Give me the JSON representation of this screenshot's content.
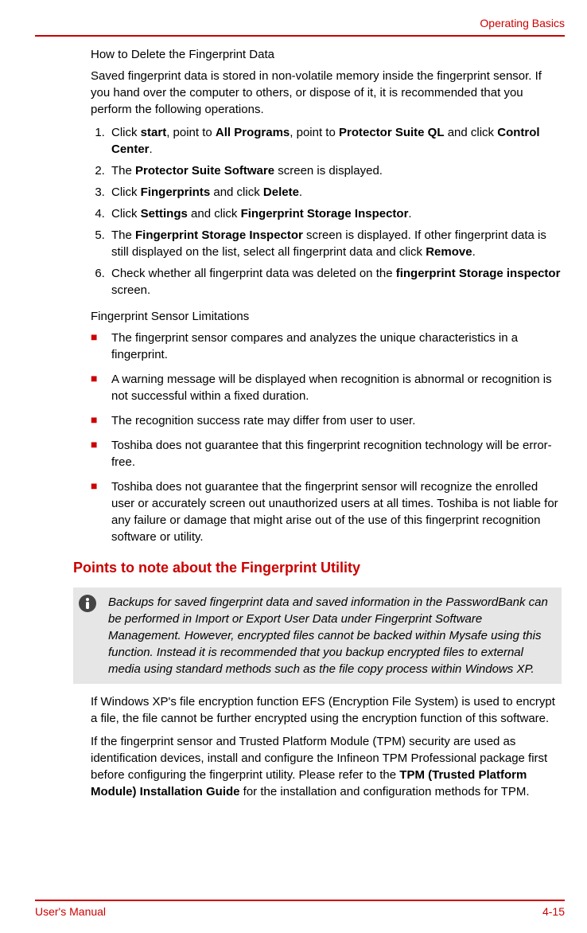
{
  "header": {
    "section_title": "Operating Basics"
  },
  "body": {
    "howto_title": "How to Delete the Fingerprint Data",
    "howto_intro": "Saved fingerprint data is stored in non-volatile memory inside the fingerprint sensor. If you hand over the computer to others, or dispose of it, it is recommended that you perform the following operations.",
    "steps": {
      "s1_pre": "Click ",
      "s1_b1": "start",
      "s1_mid1": ", point to ",
      "s1_b2": "All Programs",
      "s1_mid2": ", point to ",
      "s1_b3": "Protector Suite QL",
      "s1_mid3": " and click ",
      "s1_b4": "Control Center",
      "s1_end": ".",
      "s2_pre": "The ",
      "s2_b1": "Protector Suite Software",
      "s2_end": " screen is displayed.",
      "s3_pre": "Click ",
      "s3_b1": "Fingerprints",
      "s3_mid": " and click ",
      "s3_b2": "Delete",
      "s3_end": ".",
      "s4_pre": "Click ",
      "s4_b1": "Settings",
      "s4_mid": " and click ",
      "s4_b2": "Fingerprint Storage Inspector",
      "s4_end": ".",
      "s5_pre": "The ",
      "s5_b1": "Fingerprint Storage Inspector",
      "s5_mid": " screen is displayed. If other fingerprint data is still displayed on the list, select all fingerprint data and click ",
      "s5_b2": "Remove",
      "s5_end": ".",
      "s6_pre": "Check whether all fingerprint data was deleted on the ",
      "s6_b1": "fingerprint Storage inspector",
      "s6_end": " screen."
    },
    "limits_title": "Fingerprint Sensor Limitations",
    "bullets": [
      "The fingerprint sensor compares and analyzes the unique characteristics in a fingerprint.",
      "A warning message will be displayed when recognition is abnormal or recognition is not successful within a fixed duration.",
      "The recognition success rate may differ from user to user.",
      "Toshiba does not guarantee that this fingerprint recognition technology will be error-free.",
      "Toshiba does not guarantee that the fingerprint sensor will recognize the enrolled user or accurately screen out unauthorized users at all times. Toshiba is not liable for any failure or damage that might arise out of the use of this fingerprint recognition software or utility."
    ],
    "points_heading": "Points to note about the Fingerprint Utility",
    "note_text": "Backups for saved fingerprint data and saved information in the PasswordBank can be performed in Import or Export User Data under Fingerprint Software Management. However, encrypted files cannot be backed within Mysafe using this function. Instead it is recommended that you backup encrypted files to external media using standard methods such as the file copy process within Windows XP.",
    "efs_text": "If Windows XP's file encryption function EFS (Encryption File System) is used to encrypt a file, the file cannot be further encrypted using the encryption function of this software.",
    "tpm_pre": "If the fingerprint sensor and Trusted Platform Module (TPM) security are used as identification devices, install and configure the Infineon TPM Professional package first before configuring the fingerprint utility. Please refer to the ",
    "tpm_bold": "TPM (Trusted Platform Module) Installation Guide",
    "tpm_post": " for the installation and configuration methods for TPM."
  },
  "footer": {
    "manual": "User's Manual",
    "page_num": "4-15"
  }
}
